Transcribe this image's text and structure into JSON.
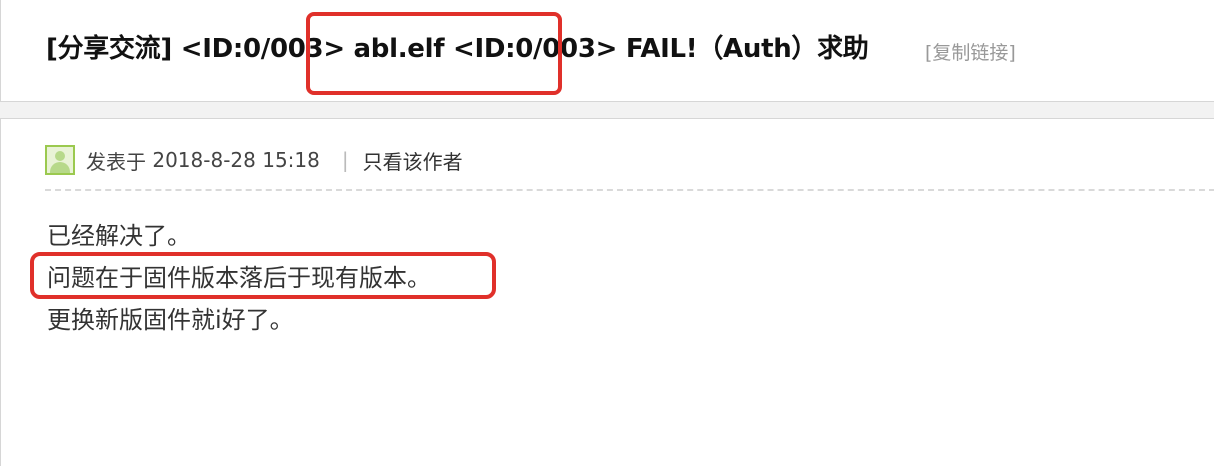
{
  "thread": {
    "title": "[分享交流] <ID:0/003> abl.elf <ID:0/003> FAIL!（Auth）求助",
    "copy_link": "[复制链接]"
  },
  "post": {
    "posted_label": "发表于",
    "posted_time": "2018-8-28 15:18",
    "separator": "|",
    "author_only": "只看该作者",
    "lines": [
      "已经解决了。",
      "问题在于固件版本落后于现有版本。",
      "更换新版固件就i好了。"
    ]
  },
  "annotation_color": "#e0302a"
}
